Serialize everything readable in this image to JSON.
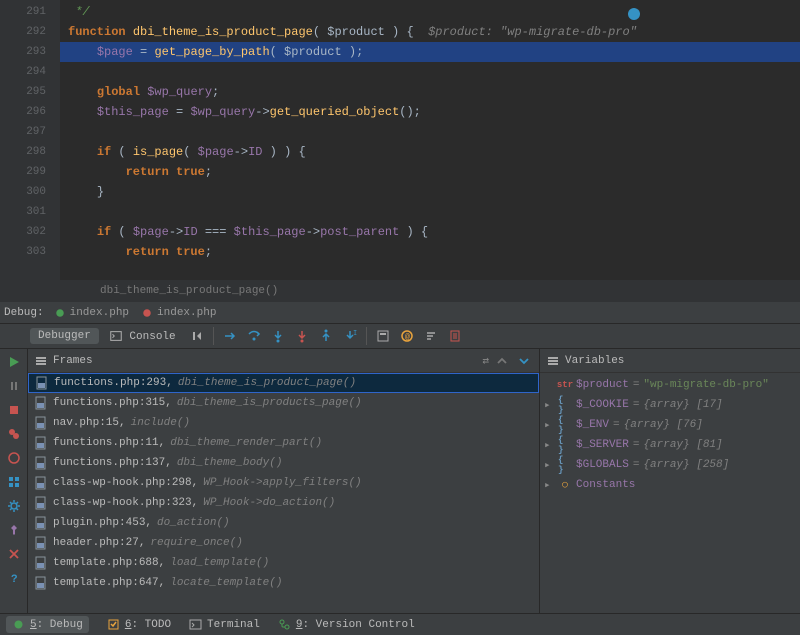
{
  "editor": {
    "lines": [
      {
        "n": 291,
        "bp": false
      },
      {
        "n": 292,
        "bp": false
      },
      {
        "n": 293,
        "bp": true,
        "hl": true
      },
      {
        "n": 294,
        "bp": false
      },
      {
        "n": 295,
        "bp": false
      },
      {
        "n": 296,
        "bp": false
      },
      {
        "n": 297,
        "bp": false
      },
      {
        "n": 298,
        "bp": false
      },
      {
        "n": 299,
        "bp": false
      },
      {
        "n": 300,
        "bp": false
      },
      {
        "n": 301,
        "bp": false
      },
      {
        "n": 302,
        "bp": false
      },
      {
        "n": 303,
        "bp": false
      }
    ],
    "breadcrumb": "dbi_theme_is_product_page()",
    "code": {
      "l291": " */",
      "l292_kw": "function ",
      "l292_fn": "dbi_theme_is_product_page",
      "l292_rest": "( $product ) {  ",
      "l292_hint_label": "$product: ",
      "l292_hint_val": "\"wp-migrate-db-pro\"",
      "l293_var": "$page",
      "l293_eq": " = ",
      "l293_fn": "get_page_by_path",
      "l293_args": "( $product );",
      "l295_kw": "global ",
      "l295_var": "$wp_query",
      "l295_semi": ";",
      "l296_var1": "$this_page",
      "l296_eq": " = ",
      "l296_var2": "$wp_query",
      "l296_arrow": "->",
      "l296_fn": "get_queried_object",
      "l296_rest": "();",
      "l298_if": "if ",
      "l298_open": "( ",
      "l298_fn": "is_page",
      "l298_a": "( ",
      "l298_var": "$page",
      "l298_arrow": "->",
      "l298_prop": "ID",
      "l298_close": " ) ) {",
      "l299_kw": "return ",
      "l299_val": "true",
      "l299_semi": ";",
      "l300": "}",
      "l302_if": "if ",
      "l302_open": "( ",
      "l302_var1": "$page",
      "l302_arrow1": "->",
      "l302_p1": "ID",
      "l302_op": " === ",
      "l302_var2": "$this_page",
      "l302_arrow2": "->",
      "l302_p2": "post_parent",
      "l302_close": " ) {",
      "l303_kw": "return ",
      "l303_val": "true",
      "l303_semi": ";"
    }
  },
  "debug": {
    "title": "Debug:",
    "tabs": [
      {
        "label": "index.php",
        "icon": "green"
      },
      {
        "label": "index.php",
        "icon": "red"
      }
    ],
    "tool_tabs": {
      "debugger": "Debugger",
      "console": "Console"
    }
  },
  "frames": {
    "title": "Frames",
    "items": [
      {
        "loc": "functions.php:293,",
        "fn": "dbi_theme_is_product_page()",
        "sel": true
      },
      {
        "loc": "functions.php:315,",
        "fn": "dbi_theme_is_products_page()"
      },
      {
        "loc": "nav.php:15,",
        "fn": "include()"
      },
      {
        "loc": "functions.php:11,",
        "fn": "dbi_theme_render_part()"
      },
      {
        "loc": "functions.php:137,",
        "fn": "dbi_theme_body()"
      },
      {
        "loc": "class-wp-hook.php:298,",
        "fn": "WP_Hook->apply_filters()"
      },
      {
        "loc": "class-wp-hook.php:323,",
        "fn": "WP_Hook->do_action()"
      },
      {
        "loc": "plugin.php:453,",
        "fn": "do_action()"
      },
      {
        "loc": "header.php:27,",
        "fn": "require_once()"
      },
      {
        "loc": "template.php:688,",
        "fn": "load_template()"
      },
      {
        "loc": "template.php:647,",
        "fn": "locate_template()"
      }
    ]
  },
  "variables": {
    "title": "Variables",
    "items": [
      {
        "expand": "",
        "icon": "str",
        "name": "$product",
        "val": "\"wp-migrate-db-pro\"",
        "type": ""
      },
      {
        "expand": "▸",
        "icon": "arr",
        "name": "$_COOKIE",
        "val": "",
        "type": "{array} [17]"
      },
      {
        "expand": "▸",
        "icon": "arr",
        "name": "$_ENV",
        "val": "",
        "type": "{array} [76]"
      },
      {
        "expand": "▸",
        "icon": "arr",
        "name": "$_SERVER",
        "val": "",
        "type": "{array} [81]"
      },
      {
        "expand": "▸",
        "icon": "arr",
        "name": "$GLOBALS",
        "val": "",
        "type": "{array} [258]"
      },
      {
        "expand": "▸",
        "icon": "const",
        "name": "Constants",
        "val": "",
        "type": ""
      }
    ]
  },
  "bottom": {
    "debug": "5: Debug",
    "todo": "6: TODO",
    "terminal": "Terminal",
    "vcs": "9: Version Control"
  }
}
